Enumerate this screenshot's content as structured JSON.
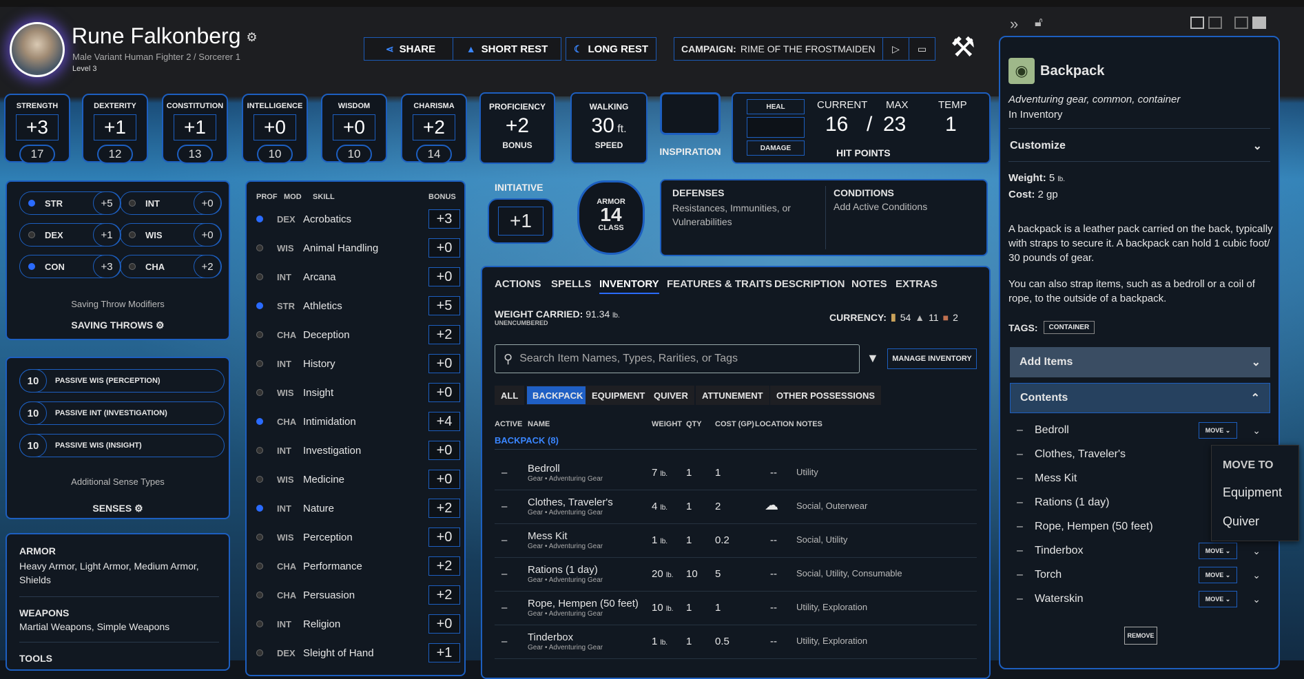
{
  "character": {
    "name": "Rune Falkonberg",
    "subtitle": "Male  Variant Human  Fighter 2 / Sorcerer 1",
    "level": "Level 3"
  },
  "toolbar": {
    "share": "SHARE",
    "short_rest": "SHORT REST",
    "long_rest": "LONG REST",
    "campaign_label": "CAMPAIGN:",
    "campaign_name": "RIME OF THE FROSTMAIDEN"
  },
  "abilities": [
    {
      "label": "STRENGTH",
      "mod": "+3",
      "score": "17"
    },
    {
      "label": "DEXTERITY",
      "mod": "+1",
      "score": "12"
    },
    {
      "label": "CONSTITUTION",
      "mod": "+1",
      "score": "13"
    },
    {
      "label": "INTELLIGENCE",
      "mod": "+0",
      "score": "10"
    },
    {
      "label": "WISDOM",
      "mod": "+0",
      "score": "10"
    },
    {
      "label": "CHARISMA",
      "mod": "+2",
      "score": "14"
    }
  ],
  "proficiency": {
    "label": "PROFICIENCY",
    "value": "+2",
    "sub": "BONUS"
  },
  "walking": {
    "label": "WALKING",
    "value": "30",
    "unit": "ft.",
    "sub": "SPEED"
  },
  "inspiration": {
    "label": "INSPIRATION"
  },
  "hp": {
    "heal": "HEAL",
    "damage": "DAMAGE",
    "current_label": "CURRENT",
    "max_label": "MAX",
    "temp_label": "TEMP",
    "current": "16",
    "sep": "/",
    "max": "23",
    "temp": "1",
    "title": "HIT POINTS"
  },
  "initiative": {
    "label": "INITIATIVE",
    "value": "+1"
  },
  "armor": {
    "label": "ARMOR",
    "value": "14",
    "sub": "CLASS"
  },
  "defenses": {
    "title": "DEFENSES",
    "text": "Resistances, Immunities, or Vulnerabilities"
  },
  "conditions": {
    "title": "CONDITIONS",
    "text": "Add Active Conditions"
  },
  "saves": [
    {
      "abbr": "STR",
      "val": "+5",
      "prof": true
    },
    {
      "abbr": "INT",
      "val": "+0",
      "prof": false
    },
    {
      "abbr": "DEX",
      "val": "+1",
      "prof": false
    },
    {
      "abbr": "WIS",
      "val": "+0",
      "prof": false
    },
    {
      "abbr": "CON",
      "val": "+3",
      "prof": true
    },
    {
      "abbr": "CHA",
      "val": "+2",
      "prof": false
    }
  ],
  "saves_footer": {
    "modifiers": "Saving Throw Modifiers",
    "title": "SAVING THROWS"
  },
  "senses": [
    {
      "val": "10",
      "label": "PASSIVE WIS (PERCEPTION)"
    },
    {
      "val": "10",
      "label": "PASSIVE INT (INVESTIGATION)"
    },
    {
      "val": "10",
      "label": "PASSIVE WIS (INSIGHT)"
    }
  ],
  "senses_footer": {
    "types": "Additional Sense Types",
    "title": "SENSES"
  },
  "proficiencies": {
    "armor_title": "ARMOR",
    "armor": "Heavy Armor, Light Armor, Medium Armor, Shields",
    "weapons_title": "WEAPONS",
    "weapons": "Martial Weapons, Simple Weapons",
    "tools_title": "TOOLS"
  },
  "skills_header": {
    "prof": "PROF",
    "mod": "MOD",
    "skill": "SKILL",
    "bonus": "BONUS"
  },
  "skills": [
    {
      "mod": "DEX",
      "name": "Acrobatics",
      "bonus": "+3",
      "prof": true
    },
    {
      "mod": "WIS",
      "name": "Animal Handling",
      "bonus": "+0",
      "prof": false
    },
    {
      "mod": "INT",
      "name": "Arcana",
      "bonus": "+0",
      "prof": false
    },
    {
      "mod": "STR",
      "name": "Athletics",
      "bonus": "+5",
      "prof": true
    },
    {
      "mod": "CHA",
      "name": "Deception",
      "bonus": "+2",
      "prof": false
    },
    {
      "mod": "INT",
      "name": "History",
      "bonus": "+0",
      "prof": false
    },
    {
      "mod": "WIS",
      "name": "Insight",
      "bonus": "+0",
      "prof": false
    },
    {
      "mod": "CHA",
      "name": "Intimidation",
      "bonus": "+4",
      "prof": true
    },
    {
      "mod": "INT",
      "name": "Investigation",
      "bonus": "+0",
      "prof": false
    },
    {
      "mod": "WIS",
      "name": "Medicine",
      "bonus": "+0",
      "prof": false
    },
    {
      "mod": "INT",
      "name": "Nature",
      "bonus": "+2",
      "prof": true
    },
    {
      "mod": "WIS",
      "name": "Perception",
      "bonus": "+0",
      "prof": false
    },
    {
      "mod": "CHA",
      "name": "Performance",
      "bonus": "+2",
      "prof": false
    },
    {
      "mod": "CHA",
      "name": "Persuasion",
      "bonus": "+2",
      "prof": false
    },
    {
      "mod": "INT",
      "name": "Religion",
      "bonus": "+0",
      "prof": false
    },
    {
      "mod": "DEX",
      "name": "Sleight of Hand",
      "bonus": "+1",
      "prof": false
    }
  ],
  "tabs": [
    "ACTIONS",
    "SPELLS",
    "INVENTORY",
    "FEATURES & TRAITS",
    "DESCRIPTION",
    "NOTES",
    "EXTRAS"
  ],
  "inventory": {
    "weight_label": "WEIGHT CARRIED:",
    "weight": "91.34",
    "weight_unit": "lb.",
    "encumbrance": "UNENCUMBERED",
    "currency_label": "CURRENCY:",
    "gold": "54",
    "silver": "11",
    "copper": "2",
    "search_placeholder": "Search Item Names, Types, Rarities, or Tags",
    "manage": "MANAGE INVENTORY",
    "filters": [
      "ALL",
      "BACKPACK",
      "EQUIPMENT",
      "QUIVER",
      "ATTUNEMENT",
      "OTHER POSSESSIONS"
    ],
    "columns": {
      "active": "ACTIVE",
      "name": "NAME",
      "weight": "WEIGHT",
      "qty": "QTY",
      "cost": "COST (GP)",
      "location": "LOCATION",
      "notes": "NOTES"
    },
    "group": "BACKPACK (8)",
    "items": [
      {
        "name": "Bedroll",
        "sub": "Gear • Adventuring Gear",
        "weight": "7",
        "qty": "1",
        "cost": "1",
        "loc": "--",
        "notes": "Utility"
      },
      {
        "name": "Clothes, Traveler's",
        "sub": "Gear • Adventuring Gear",
        "weight": "4",
        "qty": "1",
        "cost": "2",
        "loc": "",
        "notes": "Social, Outerwear"
      },
      {
        "name": "Mess Kit",
        "sub": "Gear • Adventuring Gear",
        "weight": "1",
        "qty": "1",
        "cost": "0.2",
        "loc": "--",
        "notes": "Social, Utility"
      },
      {
        "name": "Rations (1 day)",
        "sub": "Gear • Adventuring Gear",
        "weight": "20",
        "qty": "10",
        "cost": "5",
        "loc": "--",
        "notes": "Social, Utility, Consumable"
      },
      {
        "name": "Rope, Hempen (50 feet)",
        "sub": "Gear • Adventuring Gear",
        "weight": "10",
        "qty": "1",
        "cost": "1",
        "loc": "--",
        "notes": "Utility, Exploration"
      },
      {
        "name": "Tinderbox",
        "sub": "Gear • Adventuring Gear",
        "weight": "1",
        "qty": "1",
        "cost": "0.5",
        "loc": "--",
        "notes": "Utility, Exploration"
      }
    ],
    "lb": "lb."
  },
  "detail": {
    "title": "Backpack",
    "type": "Adventuring gear, common, container",
    "location": "In Inventory",
    "customize": "Customize",
    "weight_label": "Weight:",
    "weight": "5",
    "weight_unit": "lb.",
    "cost_label": "Cost:",
    "cost": "2 gp",
    "desc1": "A backpack is a leather pack carried on the back, typically with straps to secure it. A backpack can hold 1 cubic foot/ 30 pounds of gear.",
    "desc2": "You can also strap items, such as a bedroll or a coil of rope, to the outside of a backpack.",
    "tags_label": "TAGS:",
    "tag": "CONTAINER",
    "add_items": "Add Items",
    "contents": "Contents",
    "contents_items": [
      "Bedroll",
      "Clothes, Traveler's",
      "Mess Kit",
      "Rations (1 day)",
      "Rope, Hempen (50 feet)",
      "Tinderbox",
      "Torch",
      "Waterskin"
    ],
    "move": "MOVE",
    "remove": "REMOVE"
  },
  "popup": {
    "title": "MOVE TO",
    "opt1": "Equipment",
    "opt2": "Quiver"
  }
}
